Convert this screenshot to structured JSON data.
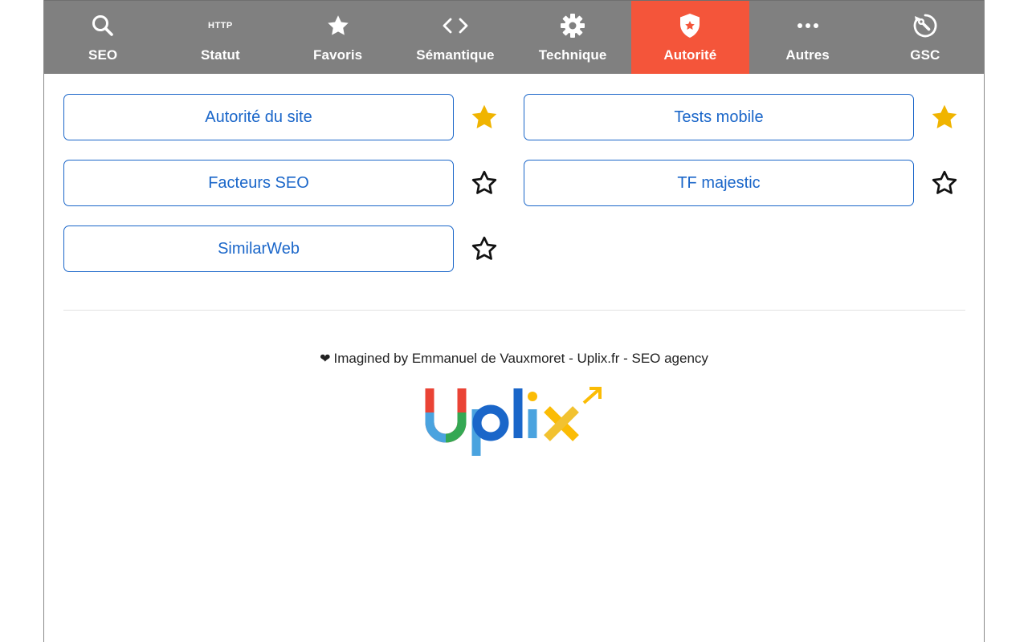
{
  "tabs": [
    {
      "id": "seo",
      "label": "SEO",
      "icon": "search-icon",
      "active": false
    },
    {
      "id": "statut",
      "label": "Statut",
      "icon": "http-icon",
      "icon_text": "HTTP",
      "active": false
    },
    {
      "id": "favoris",
      "label": "Favoris",
      "icon": "star-icon",
      "active": false
    },
    {
      "id": "semantique",
      "label": "Sémantique",
      "icon": "code-icon",
      "active": false
    },
    {
      "id": "technique",
      "label": "Technique",
      "icon": "gear-icon",
      "active": false
    },
    {
      "id": "autorite",
      "label": "Autorité",
      "icon": "shield-icon",
      "active": true
    },
    {
      "id": "autres",
      "label": "Autres",
      "icon": "more-icon",
      "active": false
    },
    {
      "id": "gsc",
      "label": "GSC",
      "icon": "tool-icon",
      "active": false
    }
  ],
  "tools": [
    {
      "label": "Autorité du site",
      "favorite": true
    },
    {
      "label": "Tests mobile",
      "favorite": true
    },
    {
      "label": "Facteurs SEO",
      "favorite": false
    },
    {
      "label": "TF majestic",
      "favorite": false
    },
    {
      "label": "SimilarWeb",
      "favorite": false
    }
  ],
  "footer": {
    "heart": "❤",
    "credit": "Imagined by Emmanuel de Vauxmoret - Uplix.fr - SEO agency",
    "logo_text": "Uplix"
  },
  "colors": {
    "tabbar": "#808080",
    "active_tab": "#f4553a",
    "link_blue": "#1a66c9",
    "star_gold": "#f0b400"
  }
}
